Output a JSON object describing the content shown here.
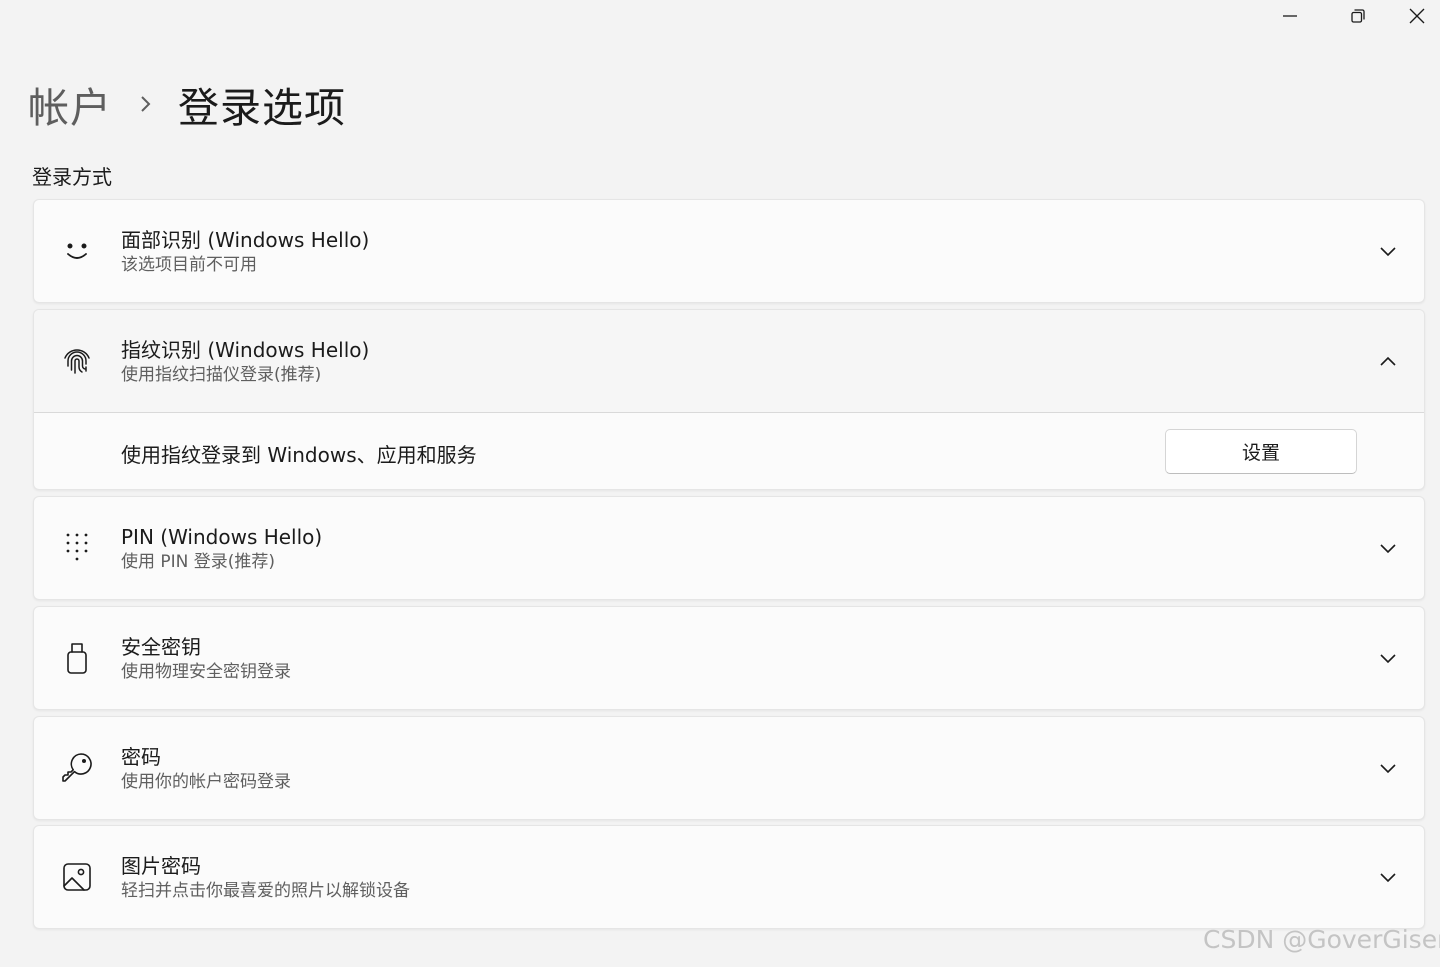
{
  "breadcrumb": {
    "parent": "帐户",
    "current": "登录选项"
  },
  "section_title": "登录方式",
  "cards": [
    {
      "title": "面部识别 (Windows Hello)",
      "subtitle": "该选项目前不可用",
      "icon": "smiley-face-icon",
      "expanded": false
    },
    {
      "title": "指纹识别 (Windows Hello)",
      "subtitle": "使用指纹扫描仪登录(推荐)",
      "icon": "fingerprint-icon",
      "expanded": true,
      "body": {
        "label": "使用指纹登录到 Windows、应用和服务",
        "button": "设置"
      }
    },
    {
      "title": "PIN (Windows Hello)",
      "subtitle": "使用 PIN 登录(推荐)",
      "icon": "keypad-icon",
      "expanded": false
    },
    {
      "title": "安全密钥",
      "subtitle": "使用物理安全密钥登录",
      "icon": "usb-key-icon",
      "expanded": false
    },
    {
      "title": "密码",
      "subtitle": "使用你的帐户密码登录",
      "icon": "key-icon",
      "expanded": false
    },
    {
      "title": "图片密码",
      "subtitle": "轻扫并点击你最喜爱的照片以解锁设备",
      "icon": "image-icon",
      "expanded": false
    }
  ],
  "watermark": "CSDN @GoverGiser",
  "colors": {
    "background": "#f3f3f3",
    "card": "#fbfbfb",
    "text": "#1b1b1b",
    "secondary_text": "#5f5f5f"
  }
}
